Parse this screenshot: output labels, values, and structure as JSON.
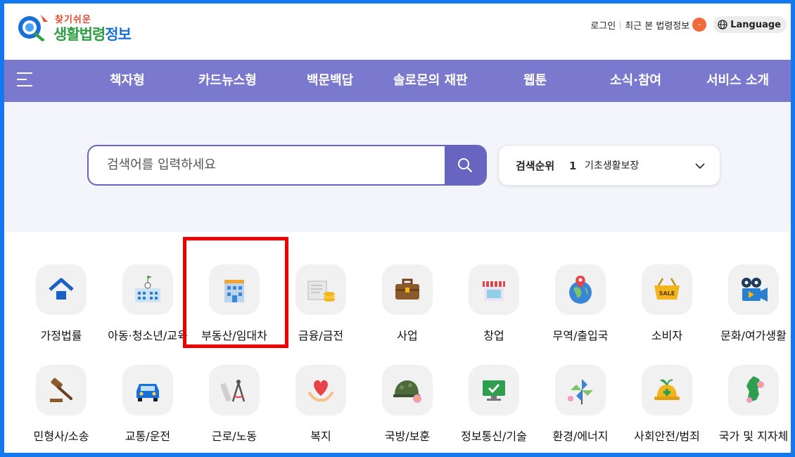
{
  "header": {
    "logo_small": "찾기쉬운",
    "logo_big_1": "생활법령",
    "logo_big_2": "정보",
    "login": "로그인",
    "recent": "최근 본 법령정보",
    "recent_count": "-",
    "language": "Language"
  },
  "nav": {
    "menu_icon": "hamburger-icon",
    "items": [
      "책자형",
      "카드뉴스형",
      "백문백답",
      "솔로몬의 재판",
      "웹툰",
      "소식·참여",
      "서비스 소개"
    ]
  },
  "search": {
    "placeholder": "검색어를 입력하세요",
    "button_icon": "search-icon",
    "rank_label": "검색순위",
    "rank_number": "1",
    "rank_keyword": "기초생활보장"
  },
  "categories": {
    "row1": [
      "가정법률",
      "아동·청소년/교육",
      "부동산/임대차",
      "금융/금전",
      "사업",
      "창업",
      "무역/출입국",
      "소비자",
      "문화/여가생활"
    ],
    "row2": [
      "민형사/소송",
      "교통/운전",
      "근로/노동",
      "복지",
      "국방/보훈",
      "정보통신/기술",
      "환경/에너지",
      "사회안전/범죄",
      "국가 및 지자체"
    ],
    "highlighted": "부동산/임대차"
  },
  "colors": {
    "accent": "#7b79cd",
    "search_border": "#6765c0",
    "highlight": "#ee0000",
    "frame": "#1478f0"
  }
}
